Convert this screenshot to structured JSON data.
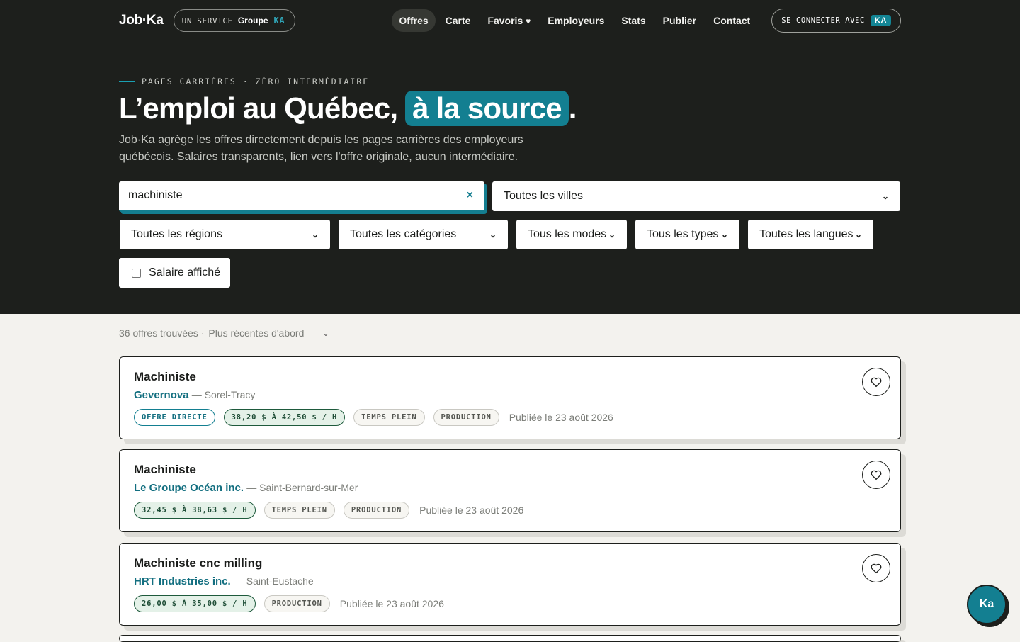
{
  "header": {
    "logo": "Job·Ka",
    "service_prefix": "UN SERVICE",
    "service_group": "Groupe",
    "service_brand": "KA",
    "nav": [
      {
        "label": "Offres",
        "active": true
      },
      {
        "label": "Carte",
        "active": false
      },
      {
        "label": "Favoris",
        "active": false,
        "icon": "heart-icon",
        "icon_glyph": "♥"
      },
      {
        "label": "Employeurs",
        "active": false
      },
      {
        "label": "Stats",
        "active": false
      },
      {
        "label": "Publier",
        "active": false
      },
      {
        "label": "Contact",
        "active": false
      }
    ],
    "login_label": "SE CONNECTER AVEC",
    "login_badge": "KA"
  },
  "hero": {
    "eyebrow": "PAGES CARRIÈRES · ZÉRO INTERMÉDIAIRE",
    "title_main": "L’emploi au Québec, ",
    "title_highlight": "à la source",
    "title_end": ".",
    "lead": "Job·Ka agrège les offres directement depuis les pages carrières des employeurs québécois. Salaires transparents, lien vers l'offre originale, aucun intermédiaire."
  },
  "filters": {
    "search_value": "machiniste",
    "clear_icon": "×",
    "city": "Toutes les villes",
    "region": "Toutes les régions",
    "category": "Toutes les catégories",
    "mode": "Tous les modes",
    "type": "Tous les types",
    "language": "Toutes les langues",
    "salary_checkbox": "Salaire affiché",
    "salary_checked": false
  },
  "results": {
    "count_text": "36 offres trouvées ·",
    "sort": "Plus récentes d'abord",
    "jobs": [
      {
        "title": "Machiniste",
        "employer": "Gevernova",
        "city": "— Sorel-Tracy",
        "direct": "OFFRE DIRECTE",
        "salary": "38,20 $ À 42,50 $ / H",
        "type": "TEMPS PLEIN",
        "category": "PRODUCTION",
        "date": "Publiée le 23 août 2026"
      },
      {
        "title": "Machiniste",
        "employer": "Le Groupe Océan inc.",
        "city": "— Saint-Bernard-sur-Mer",
        "salary": "32,45 $ À 38,63 $ / H",
        "type": "TEMPS PLEIN",
        "category": "PRODUCTION",
        "date": "Publiée le 23 août 2026"
      },
      {
        "title": "Machiniste cnc milling",
        "employer": "HRT Industries inc.",
        "city": "— Saint-Eustache",
        "salary": "26,00 $ À 35,00 $ / H",
        "category": "PRODUCTION",
        "date": "Publiée le 23 août 2026"
      }
    ]
  },
  "fab_label": "Ka",
  "colors": {
    "accent": "#137f91",
    "dark": "#1d1f1c",
    "background": "#f3f2ee"
  }
}
